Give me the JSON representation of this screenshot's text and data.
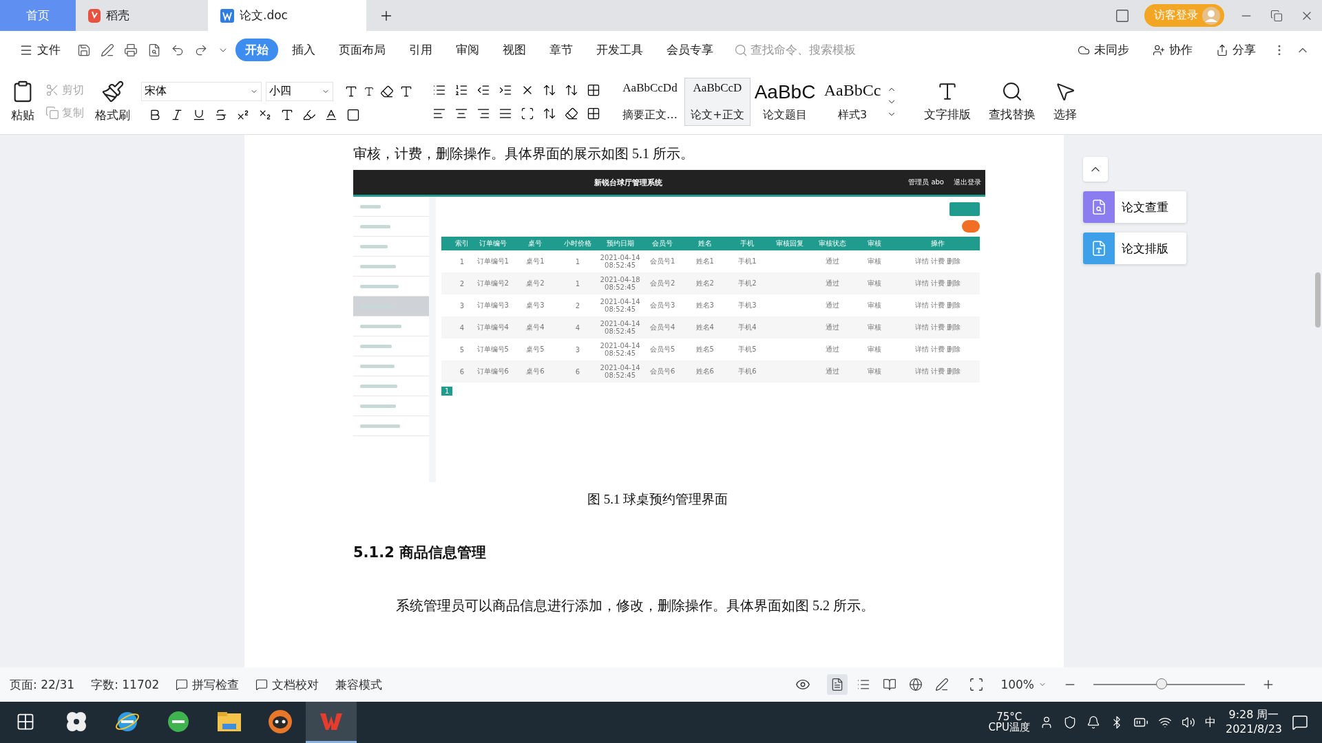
{
  "tabs": [
    {
      "label": "首页",
      "kind": "home",
      "selected": false
    },
    {
      "label": "稻壳",
      "kind": "app",
      "selected": false
    },
    {
      "label": "论文.doc",
      "kind": "doc",
      "selected": true
    }
  ],
  "login": "访客登录",
  "menu": {
    "file": "文件",
    "tabs": [
      {
        "label": "开始",
        "selected": true
      },
      {
        "label": "插入",
        "selected": false
      },
      {
        "label": "页面布局",
        "selected": false
      },
      {
        "label": "引用",
        "selected": false
      },
      {
        "label": "审阅",
        "selected": false
      },
      {
        "label": "视图",
        "selected": false
      },
      {
        "label": "章节",
        "selected": false
      },
      {
        "label": "开发工具",
        "selected": false
      },
      {
        "label": "会员专享",
        "selected": false
      }
    ],
    "search": {
      "placeholder": "查找命令、搜索模板"
    },
    "actions": [
      {
        "kind": "sync",
        "label": "未同步"
      },
      {
        "kind": "collab",
        "label": "协作"
      },
      {
        "kind": "share",
        "label": "分享"
      }
    ]
  },
  "ribbon": {
    "paste": "粘贴",
    "cut": {
      "label": "剪切",
      "disabled": true
    },
    "copy": {
      "label": "复制",
      "disabled": true
    },
    "painter": "格式刷",
    "font": "宋体",
    "size": "小四",
    "styles": [
      {
        "sample": "AaBbCcDd",
        "name": "摘要正文…",
        "selected": false
      },
      {
        "sample": "AaBbCcD",
        "name": "论文+正文",
        "selected": true
      },
      {
        "sample": "AaBbC",
        "name": "论文题目",
        "selected": false
      },
      {
        "sample": "AaBbCc",
        "name": "样式3",
        "selected": false
      }
    ],
    "tools": [
      {
        "kind": "layout",
        "label": "文字排版"
      },
      {
        "kind": "find",
        "label": "查找替换"
      },
      {
        "kind": "select",
        "label": "选择"
      }
    ]
  },
  "document": {
    "intro": "审核，计费，删除操作。具体界面的展示如图 5.1 所示。",
    "figure": {
      "title": "新锐台球厅管理系统",
      "user": "管理员 abo",
      "logout": "退出登录",
      "columns": [
        "索引",
        "订单编号",
        "桌号",
        "小时价格",
        "预约日期",
        "会员号",
        "姓名",
        "手机",
        "审核回复",
        "审核状态",
        "审核",
        "操作"
      ],
      "rows": [
        [
          "1",
          "订单编号1",
          "桌号1",
          "1",
          "2021-04-14 08:52:45",
          "会员号1",
          "姓名1",
          "手机1",
          "",
          "通过",
          "审核",
          "详情 计费 删除"
        ],
        [
          "2",
          "订单编号2",
          "桌号2",
          "1",
          "2021-04-18 08:52:45",
          "会员号2",
          "姓名2",
          "手机2",
          "",
          "通过",
          "审核",
          "详情 计费 删除"
        ],
        [
          "3",
          "订单编号3",
          "桌号3",
          "2",
          "2021-04-14 08:52:45",
          "会员号3",
          "姓名3",
          "手机3",
          "",
          "通过",
          "审核",
          "详情 计费 删除"
        ],
        [
          "4",
          "订单编号4",
          "桌号4",
          "4",
          "2021-04-14 08:52:45",
          "会员号4",
          "姓名4",
          "手机4",
          "",
          "通过",
          "审核",
          "详情 计费 删除"
        ],
        [
          "5",
          "订单编号5",
          "桌号5",
          "3",
          "2021-04-14 08:52:45",
          "会员号5",
          "姓名5",
          "手机5",
          "",
          "通过",
          "审核",
          "详情 计费 删除"
        ],
        [
          "6",
          "订单编号6",
          "桌号6",
          "6",
          "2021-04-14 08:52:45",
          "会员号6",
          "姓名6",
          "手机6",
          "",
          "通过",
          "审核",
          "详情 计费 删除"
        ]
      ],
      "page": "1"
    },
    "caption": "图 5.1  球桌预约管理界面",
    "heading": "5.1.2  商品信息管理",
    "paragraph": "系统管理员可以商品信息进行添加，修改，删除操作。具体界面如图 5.2 所示。"
  },
  "side_panel": [
    {
      "label": "论文查重",
      "color": "#8b7cf0"
    },
    {
      "label": "论文排版",
      "color": "#3ea0e8"
    }
  ],
  "status_bar": {
    "page": "页面: 22/31",
    "words": "字数: 11702",
    "spell": "拼写检查",
    "proof": "文档校对",
    "mode": "兼容模式",
    "views": [
      {
        "kind": "page",
        "selected": true
      },
      {
        "kind": "outline",
        "selected": false
      },
      {
        "kind": "read",
        "selected": false
      },
      {
        "kind": "web",
        "selected": false
      },
      {
        "kind": "write",
        "selected": false
      }
    ],
    "zoom": "100%",
    "zoom_level": {
      "level": 0.45
    }
  },
  "taskbar": {
    "apps": [
      {
        "kind": "pinwheel",
        "selected": false
      },
      {
        "kind": "ie",
        "selected": false
      },
      {
        "kind": "browser",
        "selected": false
      },
      {
        "kind": "folder",
        "selected": false
      },
      {
        "kind": "raccoon",
        "selected": false
      },
      {
        "kind": "wps",
        "selected": true
      }
    ],
    "temp": "75°C",
    "temp_label": "CPU温度",
    "ime": "中",
    "time": "9:28 周一",
    "date": "2021/8/23"
  }
}
